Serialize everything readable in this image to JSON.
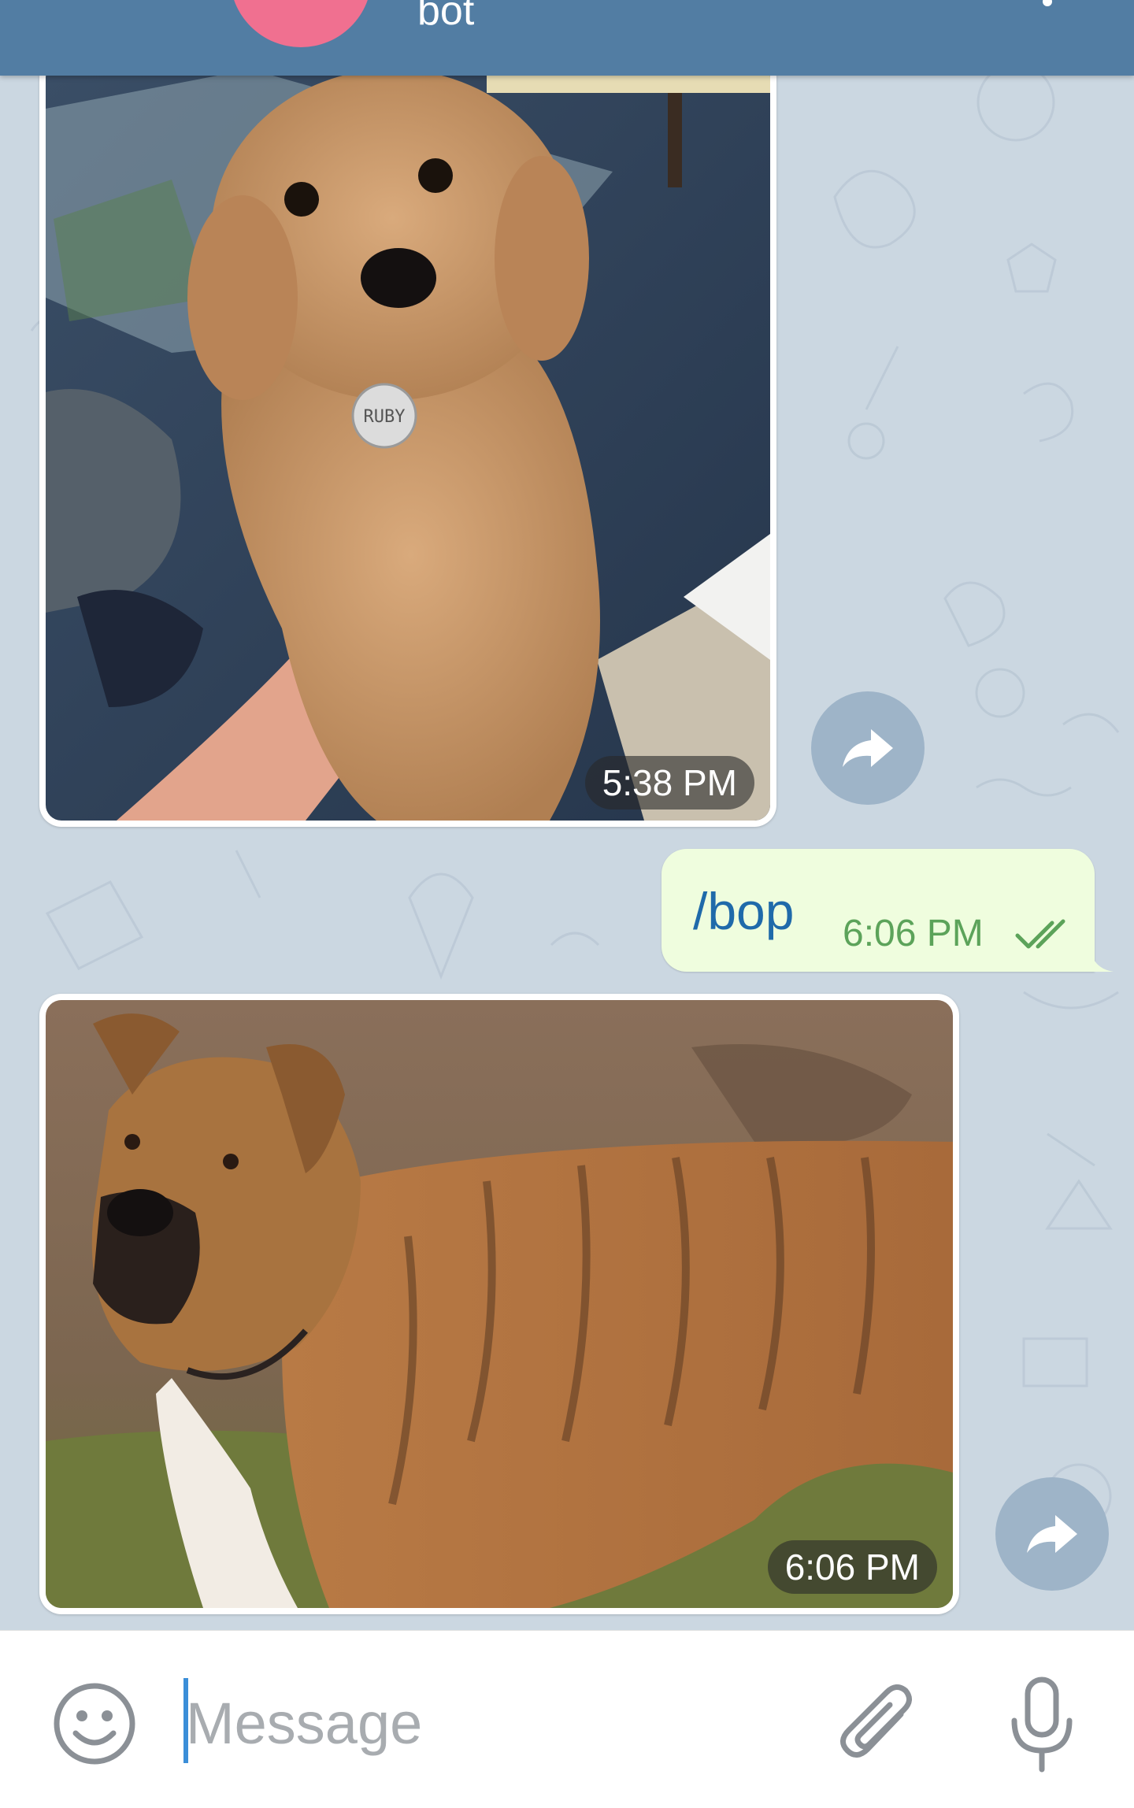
{
  "header": {
    "name": "bot",
    "avatar_color": "#f07090",
    "bar_color": "#527da3"
  },
  "messages": [
    {
      "type": "photo",
      "direction": "incoming",
      "subject": "poodle-puppy-photo",
      "collar_tag_text": "RUBY",
      "time": "5:38 PM"
    },
    {
      "type": "text",
      "direction": "outgoing",
      "text": "/bop",
      "time": "6:06 PM",
      "status": "read"
    },
    {
      "type": "photo",
      "direction": "incoming",
      "subject": "brindle-dog-photo",
      "time": "6:06 PM"
    }
  ],
  "input": {
    "placeholder": "Message"
  },
  "icons": {
    "back": "back-arrow-icon",
    "menu": "more-vert-icon",
    "forward": "share-forward-icon",
    "check": "double-check-icon",
    "emoji": "smiley-icon",
    "attach": "paperclip-icon",
    "mic": "microphone-icon"
  },
  "colors": {
    "outgoing_bubble": "#effdde",
    "outgoing_text": "#1f6aaa",
    "outgoing_time": "#5ca35a",
    "chat_background": "#cbd7e1",
    "cursor": "#3b8ed8"
  }
}
